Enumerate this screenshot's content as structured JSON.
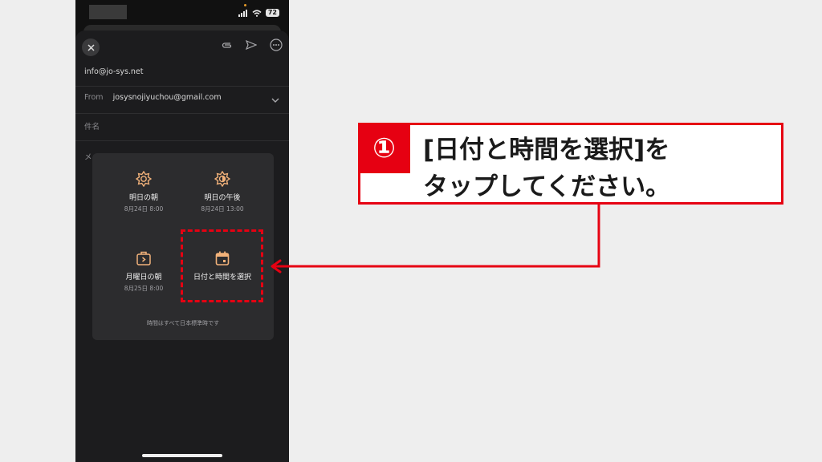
{
  "compose": {
    "to": "info@jo-sys.net",
    "from_label": "From",
    "from_value": "josysnojiyuchou@gmail.com",
    "subject_placeholder": "件名",
    "body_placeholder": "メ"
  },
  "status_bar": {
    "battery": "72"
  },
  "schedule_popup": {
    "options": [
      {
        "label": "明日の朝",
        "sub": "8月24日 8:00",
        "icon": "sun-icon"
      },
      {
        "label": "明日の午後",
        "sub": "8月24日 13:00",
        "icon": "half-sun-icon"
      },
      {
        "label": "月曜日の朝",
        "sub": "8月25日 8:00",
        "icon": "briefcase-icon"
      },
      {
        "label": "日付と時間を選択",
        "sub": "",
        "icon": "calendar-icon"
      }
    ],
    "footnote": "時間はすべて日本標準時です"
  },
  "callout": {
    "number": "①",
    "line1": "[日付と時間を選択]を",
    "line2": "タップしてください。"
  },
  "colors": {
    "accent_red": "#e60012",
    "icon_orange": "#f2b27a"
  }
}
